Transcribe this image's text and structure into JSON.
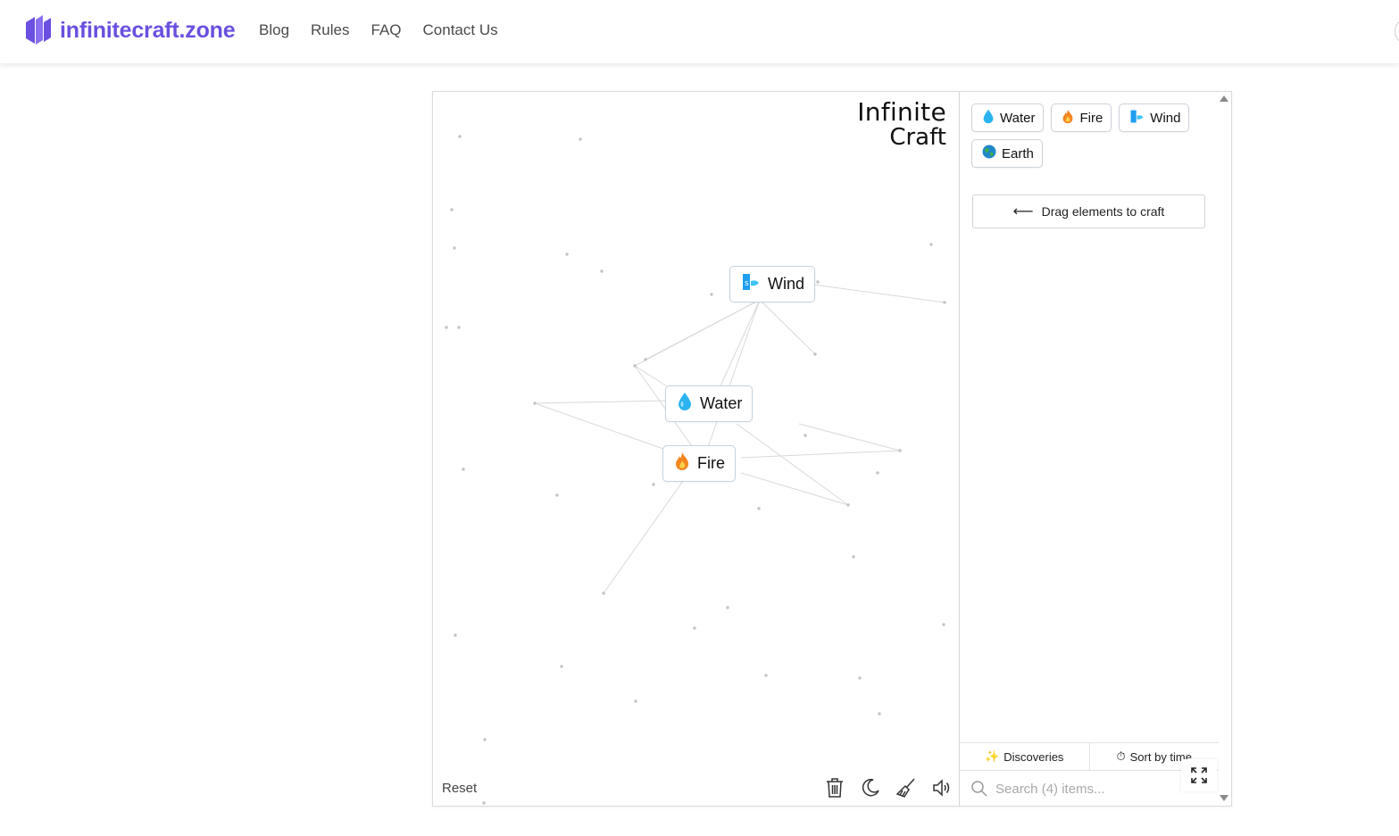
{
  "header": {
    "brand": "infinitecraft.zone",
    "nav": [
      "Blog",
      "Rules",
      "FAQ",
      "Contact Us"
    ],
    "brand_color": "#6a4fe0"
  },
  "canvas": {
    "logo_line1": "Infinite",
    "logo_line2": "Craft",
    "items": [
      {
        "label": "Wind",
        "icon": "wind-icon"
      },
      {
        "label": "Water",
        "icon": "water-drop-icon"
      },
      {
        "label": "Fire",
        "icon": "fire-icon"
      }
    ],
    "reset_label": "Reset",
    "tools": [
      "trash-icon",
      "moon-icon",
      "broom-icon",
      "speaker-icon"
    ]
  },
  "sidebar": {
    "elements": [
      {
        "label": "Water",
        "icon": "water-drop-icon"
      },
      {
        "label": "Fire",
        "icon": "fire-icon"
      },
      {
        "label": "Wind",
        "icon": "wind-icon"
      },
      {
        "label": "Earth",
        "icon": "earth-globe-icon"
      }
    ],
    "hint": "Drag elements to craft",
    "discoveries_label": "Discoveries",
    "sort_label": "Sort by time",
    "search_placeholder": "Search (4) items..."
  }
}
